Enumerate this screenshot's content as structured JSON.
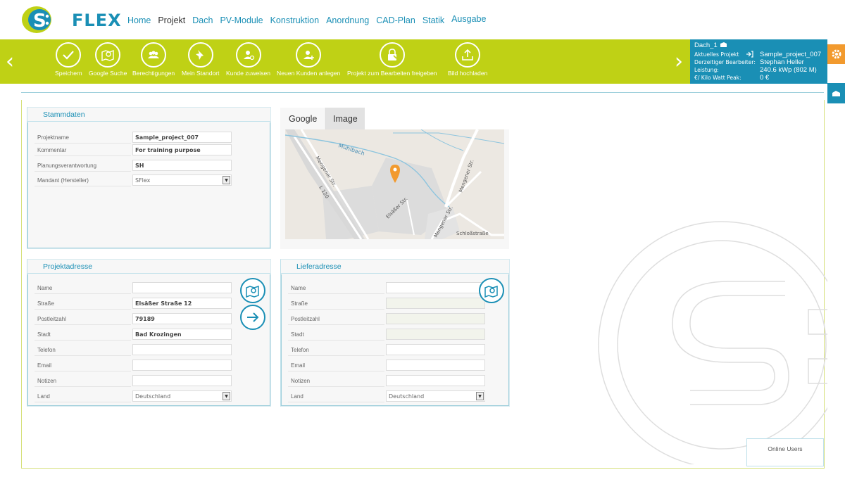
{
  "logo": {
    "text": "FLEX",
    "mark": "S"
  },
  "nav": [
    "Home",
    "Projekt",
    "Dach",
    "PV-Module",
    "Konstruktion",
    "Anordnung",
    "CAD-Plan",
    "Statik",
    "Ausgabe"
  ],
  "toolbar": {
    "items": [
      {
        "label": "Speichern",
        "icon": "check-icon"
      },
      {
        "label": "Google Suche",
        "icon": "map-search-icon"
      },
      {
        "label": "Berechtigungen",
        "icon": "users-icon"
      },
      {
        "label": "Mein Standort",
        "icon": "pin-icon"
      },
      {
        "label": "Kunde zuweisen",
        "icon": "user-assign-icon"
      },
      {
        "label": "Neuen Kunden anlegen",
        "icon": "user-add-icon"
      },
      {
        "label": "Projekt zum Bearbeiten freigeben",
        "icon": "lock-edit-icon"
      },
      {
        "label": "Bild hochladen",
        "icon": "upload-icon"
      }
    ],
    "prev_arrow": "‹",
    "next_arrow": "›"
  },
  "info": {
    "dach": "Dach_1",
    "rows": [
      {
        "label": "Aktuelles Projekt",
        "value": "Sample_project_007"
      },
      {
        "label": "Derzeitiger Bearbeiter:",
        "value": "Stephan Heller"
      },
      {
        "label": "Leistung:",
        "value": "240.6 kWp (802 M)"
      },
      {
        "label": "€/ Kilo Watt Peak:",
        "value": "0 €"
      }
    ]
  },
  "stammdaten": {
    "title": "Stammdaten",
    "fields": [
      {
        "label": "Projektname",
        "value": "Sample_project_007"
      },
      {
        "label": "Kommentar",
        "value": "For training purpose"
      },
      {
        "label": "Planungsverantwortung",
        "value": "SH"
      },
      {
        "label": "Mandant (Hersteller)",
        "value": "SFlex"
      }
    ]
  },
  "map_tabs": [
    "Google",
    "Image"
  ],
  "map_labels": {
    "river": "Mühlbach",
    "road1": "Mengener Str.",
    "road2": "L 120",
    "road3": "Mengener Str.",
    "road4": "Elsäßer Str.",
    "road5": "Mengener Str.",
    "road6": "Schloßstraße"
  },
  "projektadresse": {
    "title": "Projektadresse",
    "fields": [
      {
        "label": "Name",
        "value": ""
      },
      {
        "label": "Straße",
        "value": "Elsäßer Straße 12"
      },
      {
        "label": "Postleitzahl",
        "value": "79189"
      },
      {
        "label": "Stadt",
        "value": "Bad Krozingen"
      },
      {
        "label": "Telefon",
        "value": ""
      },
      {
        "label": "Email",
        "value": ""
      },
      {
        "label": "Notizen",
        "value": ""
      },
      {
        "label": "Land",
        "value": "Deutschland"
      }
    ]
  },
  "lieferadresse": {
    "title": "Lieferadresse",
    "fields": [
      {
        "label": "Name",
        "value": ""
      },
      {
        "label": "Straße",
        "value": ""
      },
      {
        "label": "Postleitzahl",
        "value": ""
      },
      {
        "label": "Stadt",
        "value": ""
      },
      {
        "label": "Telefon",
        "value": ""
      },
      {
        "label": "Email",
        "value": ""
      },
      {
        "label": "Notizen",
        "value": ""
      },
      {
        "label": "Land",
        "value": "Deutschland"
      }
    ]
  },
  "online_users": "Online Users",
  "colors": {
    "accent_green": "#bfd115",
    "accent_blue": "#1a8fb5",
    "accent_orange": "#f29a2e"
  }
}
